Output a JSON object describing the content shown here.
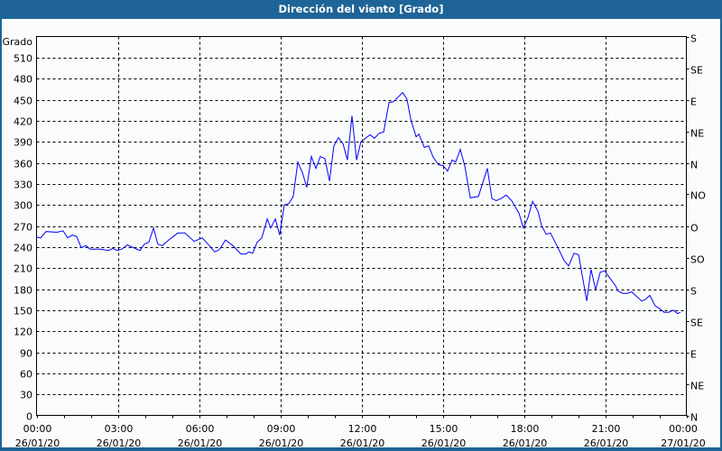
{
  "window": {
    "title": "Dirección del viento [Grado]"
  },
  "chart_data": {
    "type": "line",
    "title": "Dirección del viento [Grado]",
    "ylabel": "Grado",
    "xlabel": "",
    "ylim": [
      0,
      540
    ],
    "xlim_hours": [
      0,
      24
    ],
    "grid": true,
    "line_color": "#0000ff",
    "y_ticks": [
      0,
      30,
      60,
      90,
      120,
      150,
      180,
      210,
      240,
      270,
      300,
      330,
      360,
      390,
      420,
      450,
      480,
      510
    ],
    "y_tick_labels": [
      "0",
      "30",
      "60",
      "90",
      "120",
      "150",
      "180",
      "210",
      "240",
      "270",
      "300",
      "330",
      "360",
      "390",
      "420",
      "450",
      "480",
      "510"
    ],
    "right_axis_ticks": [
      0,
      45,
      90,
      135,
      180,
      225,
      270,
      315,
      360,
      405,
      450,
      495,
      540
    ],
    "right_axis_labels": [
      "N",
      "NE",
      "E",
      "SE",
      "S",
      "SO",
      "O",
      "NO",
      "N",
      "NE",
      "E",
      "SE",
      "S"
    ],
    "x_ticks_hours": [
      0,
      3,
      6,
      9,
      12,
      15,
      18,
      21,
      24
    ],
    "x_tick_labels": [
      {
        "time": "00:00",
        "date": "26/01/20"
      },
      {
        "time": "03:00",
        "date": "26/01/20"
      },
      {
        "time": "06:00",
        "date": "26/01/20"
      },
      {
        "time": "09:00",
        "date": "26/01/20"
      },
      {
        "time": "12:00",
        "date": "26/01/20"
      },
      {
        "time": "15:00",
        "date": "26/01/20"
      },
      {
        "time": "18:00",
        "date": "26/01/20"
      },
      {
        "time": "21:00",
        "date": "26/01/20"
      },
      {
        "time": "00:00",
        "date": "27/01/20"
      }
    ],
    "series": [
      {
        "name": "Dirección del viento",
        "points": [
          [
            0.0,
            254
          ],
          [
            0.15,
            253
          ],
          [
            0.35,
            262
          ],
          [
            0.75,
            261
          ],
          [
            0.98,
            263
          ],
          [
            1.15,
            253
          ],
          [
            1.32,
            257
          ],
          [
            1.48,
            255
          ],
          [
            1.65,
            239
          ],
          [
            1.82,
            242
          ],
          [
            1.98,
            237
          ],
          [
            2.38,
            237
          ],
          [
            2.65,
            235
          ],
          [
            2.82,
            238
          ],
          [
            2.98,
            235
          ],
          [
            3.15,
            237
          ],
          [
            3.35,
            243
          ],
          [
            3.82,
            235
          ],
          [
            3.98,
            244
          ],
          [
            4.15,
            247
          ],
          [
            4.32,
            267
          ],
          [
            4.48,
            244
          ],
          [
            4.65,
            242
          ],
          [
            4.88,
            250
          ],
          [
            5.22,
            260
          ],
          [
            5.48,
            260
          ],
          [
            5.82,
            248
          ],
          [
            6.12,
            253
          ],
          [
            6.38,
            242
          ],
          [
            6.58,
            233
          ],
          [
            6.75,
            236
          ],
          [
            6.98,
            250
          ],
          [
            7.25,
            242
          ],
          [
            7.55,
            230
          ],
          [
            7.72,
            230
          ],
          [
            7.85,
            233
          ],
          [
            7.98,
            231
          ],
          [
            8.15,
            247
          ],
          [
            8.32,
            253
          ],
          [
            8.52,
            280
          ],
          [
            8.65,
            267
          ],
          [
            8.82,
            280
          ],
          [
            8.98,
            257
          ],
          [
            9.15,
            300
          ],
          [
            9.32,
            302
          ],
          [
            9.48,
            312
          ],
          [
            9.65,
            361
          ],
          [
            9.82,
            346
          ],
          [
            9.98,
            325
          ],
          [
            10.15,
            369
          ],
          [
            10.32,
            352
          ],
          [
            10.48,
            369
          ],
          [
            10.65,
            366
          ],
          [
            10.82,
            334
          ],
          [
            10.98,
            384
          ],
          [
            11.15,
            396
          ],
          [
            11.32,
            387
          ],
          [
            11.48,
            364
          ],
          [
            11.65,
            427
          ],
          [
            11.82,
            364
          ],
          [
            11.98,
            390
          ],
          [
            12.32,
            400
          ],
          [
            12.48,
            395
          ],
          [
            12.65,
            402
          ],
          [
            12.82,
            404
          ],
          [
            13.02,
            446
          ],
          [
            13.18,
            447
          ],
          [
            13.52,
            460
          ],
          [
            13.68,
            451
          ],
          [
            13.82,
            422
          ],
          [
            14.02,
            397
          ],
          [
            14.12,
            401
          ],
          [
            14.32,
            382
          ],
          [
            14.48,
            384
          ],
          [
            14.65,
            368
          ],
          [
            14.85,
            357
          ],
          [
            15.02,
            356
          ],
          [
            15.18,
            348
          ],
          [
            15.35,
            364
          ],
          [
            15.48,
            361
          ],
          [
            15.65,
            379
          ],
          [
            15.82,
            355
          ],
          [
            16.02,
            310
          ],
          [
            16.32,
            312
          ],
          [
            16.65,
            352
          ],
          [
            16.82,
            309
          ],
          [
            16.98,
            306
          ],
          [
            17.15,
            309
          ],
          [
            17.35,
            314
          ],
          [
            17.55,
            306
          ],
          [
            17.82,
            288
          ],
          [
            17.98,
            267
          ],
          [
            18.15,
            282
          ],
          [
            18.32,
            305
          ],
          [
            18.52,
            291
          ],
          [
            18.65,
            271
          ],
          [
            18.82,
            258
          ],
          [
            18.98,
            260
          ],
          [
            19.22,
            242
          ],
          [
            19.48,
            221
          ],
          [
            19.65,
            213
          ],
          [
            19.85,
            231
          ],
          [
            20.02,
            229
          ],
          [
            20.18,
            194
          ],
          [
            20.32,
            163
          ],
          [
            20.48,
            208
          ],
          [
            20.65,
            179
          ],
          [
            20.82,
            204
          ],
          [
            20.98,
            206
          ],
          [
            21.15,
            197
          ],
          [
            21.38,
            185
          ],
          [
            21.48,
            177
          ],
          [
            21.65,
            174
          ],
          [
            21.82,
            174
          ],
          [
            21.98,
            176
          ],
          [
            22.15,
            170
          ],
          [
            22.35,
            163
          ],
          [
            22.48,
            165
          ],
          [
            22.65,
            171
          ],
          [
            22.85,
            156
          ],
          [
            23.02,
            152
          ],
          [
            23.18,
            147
          ],
          [
            23.35,
            147
          ],
          [
            23.52,
            150
          ],
          [
            23.68,
            145
          ],
          [
            23.78,
            147
          ]
        ]
      }
    ]
  }
}
